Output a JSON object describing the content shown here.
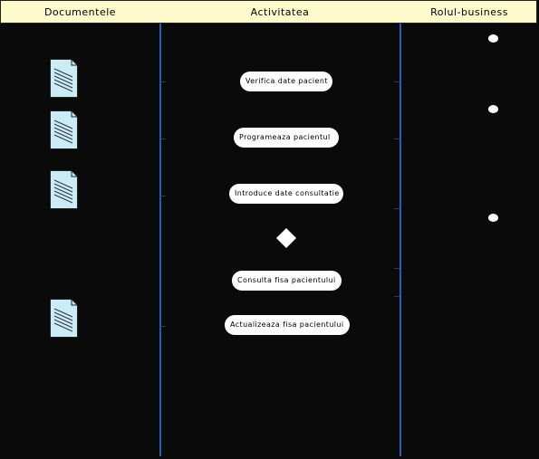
{
  "lanes": {
    "documents": "Documentele",
    "activity": "Activitatea",
    "business_role": "Rolul-business"
  },
  "activities": [
    "Verifica date pacient",
    "Programeaza pacientul",
    "Introduce date consultatie",
    "Consulta fisa pacientului",
    "Actualizeaza fisa pacientului"
  ],
  "colors": {
    "header_bg": "#fffbcc",
    "lane_line": "#2a5bbd",
    "document_fill": "#c9ecf5",
    "background": "#0a0a0a"
  }
}
